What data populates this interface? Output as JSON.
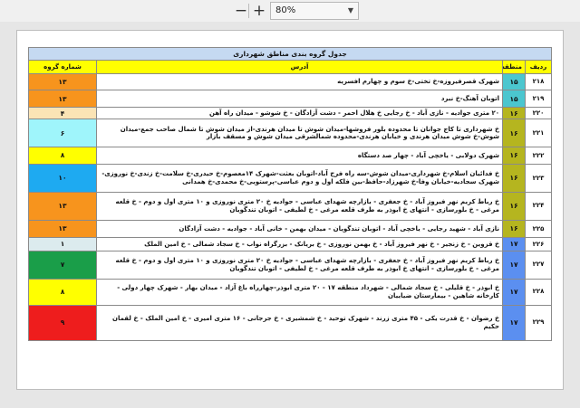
{
  "toolbar": {
    "zoom_value": "80%"
  },
  "table": {
    "title": "جدول گروه بندی مناطق شهرداری",
    "headers": {
      "row": "ردیف",
      "zone": "منطقه",
      "address": "آدرس",
      "group": "شماره گروه"
    },
    "rows": [
      {
        "row": "۲۱۸",
        "zone": "۱۵",
        "zone_color": "#4bc6cf",
        "address": "شهرک قصرفیروزه-خ تختی-خ سوم و چهارم افسریه",
        "group": "۱۳",
        "group_color": "#f7941d"
      },
      {
        "row": "۲۱۹",
        "zone": "۱۵",
        "zone_color": "#4bc6cf",
        "address": "اتوبان آهنگ-خ نبرد",
        "group": "۱۳",
        "group_color": "#f7941d"
      },
      {
        "row": "۲۲۰",
        "zone": "۱۶",
        "zone_color": "#b5b51f",
        "address": "۲۰ متری جوادیه - نازی آباد - خ رجایی خ هلال احمر - دشت آزادگان - خ شوشو - میدان راه آهن",
        "group": "۴",
        "group_color": "#fbe4b5"
      },
      {
        "row": "۲۲۱",
        "zone": "۱۶",
        "zone_color": "#b5b51f",
        "address": "خ شهرداری تا کاج جوانان تا محدوده بلور فروشها-میدان شوش تا میدان هرندی-از میدان شوش تا شمال صاحب جمع-میدان شوش-خ شوش میدان هرندی و خیابان هرندی-محدوده شمالشرقی میدان شوش و مسقف بازار",
        "group": "۶",
        "group_color": "#9ff5fb"
      },
      {
        "row": "۲۲۲",
        "zone": "۱۶",
        "zone_color": "#b5b51f",
        "address": "شهرک دولابی - یاخچی آباد - چهار صد دستگاه",
        "group": "۸",
        "group_color": "#ffff00"
      },
      {
        "row": "۲۲۳",
        "zone": "۱۶",
        "zone_color": "#b5b51f",
        "address": "خ فدائیان اسلام-خ شهرداری-میدان شوش-سه راه فرح آباد-اتوبان بعثت-شهرک ۱۴معصوم-خ حیدری-خ سلامت-خ زندی-خ نوروزی-شهرک سجادیه-خیابان وفا-خ شهرزاد-حافظ-بین فلکه اول و دوم عباسی-پرستویی-خ محمدی-خ همدانی",
        "group": "۱۰",
        "group_color": "#1eaaf1"
      },
      {
        "row": "۲۲۴",
        "zone": "۱۶",
        "zone_color": "#b5b51f",
        "address": "خ رباط کریم نهر فیروز آباد - خ جعفری - بازارچه شهدای عباسی - جوادیه خ ۲۰ متری نوروزی و ۱۰ متری اول و دوم - خ قلعه مرغی - خ بلورسازی - انتهای خ ابوذر به طرف قلعه مرغی - خ لطیفی - اتوبان تندگویان",
        "group": "۱۳",
        "group_color": "#f7941d"
      },
      {
        "row": "۲۲۵",
        "zone": "۱۶",
        "zone_color": "#b5b51f",
        "address": "نازی آباد - شهید رجایی - یاخچی آباد - اتوبان تندگویان - میدان بهمن - خانی آباد - جوادیه - دشت آزادگان",
        "group": "۱۳",
        "group_color": "#f7941d"
      },
      {
        "row": "۲۲۶",
        "zone": "۱۷",
        "zone_color": "#5b8ff0",
        "address": "خ قزوین - خ زنجیر - خ نهر فیروز آباد - خ بهمن نوروزی - خ بریانک - بزرگراه نواب - خ سجاد شمالی - خ امین الملک",
        "group": "۱",
        "group_color": "#dcebee"
      },
      {
        "row": "۲۲۷",
        "zone": "۱۷",
        "zone_color": "#5b8ff0",
        "address": "خ رباط کریم نهر فیروز آباد - خ جعفری - بازارچه شهدای عباسی - جوادیه خ ۲۰ متری نوروزی و ۱۰ متری اول و دوم - خ قلعه مرغی - خ بلورسازی - انتهای خ ابوذر به طرف قلعه مرغی - خ لطیفی - اتوبان تندگویان",
        "group": "۷",
        "group_color": "#1a9e49"
      },
      {
        "row": "۲۲۸",
        "zone": "۱۷",
        "zone_color": "#5b8ff0",
        "address": "خ ابوذر - خ قلیلی - خ سجاد شمالی - شهرداد منطقه ۱۷ - ۲۰ متری ابوذر-چهارراه باغ آزاد - میدان بهار - شهرک چهار دولی - کارخانه شاهین - بیمارستان ضیاییان",
        "group": "۸",
        "group_color": "#ffff00"
      },
      {
        "row": "۲۲۹",
        "zone": "۱۷",
        "zone_color": "#5b8ff0",
        "address": "خ رضوان - خ قدرت یکی - ۴۵ متری زرند - شهرک توحید - خ شمشیری - خ جرجانی - ۱۶ متری امیری - خ امین الملک - خ لقمان حکیم",
        "group": "۹",
        "group_color": "#ee1d1d"
      }
    ]
  }
}
